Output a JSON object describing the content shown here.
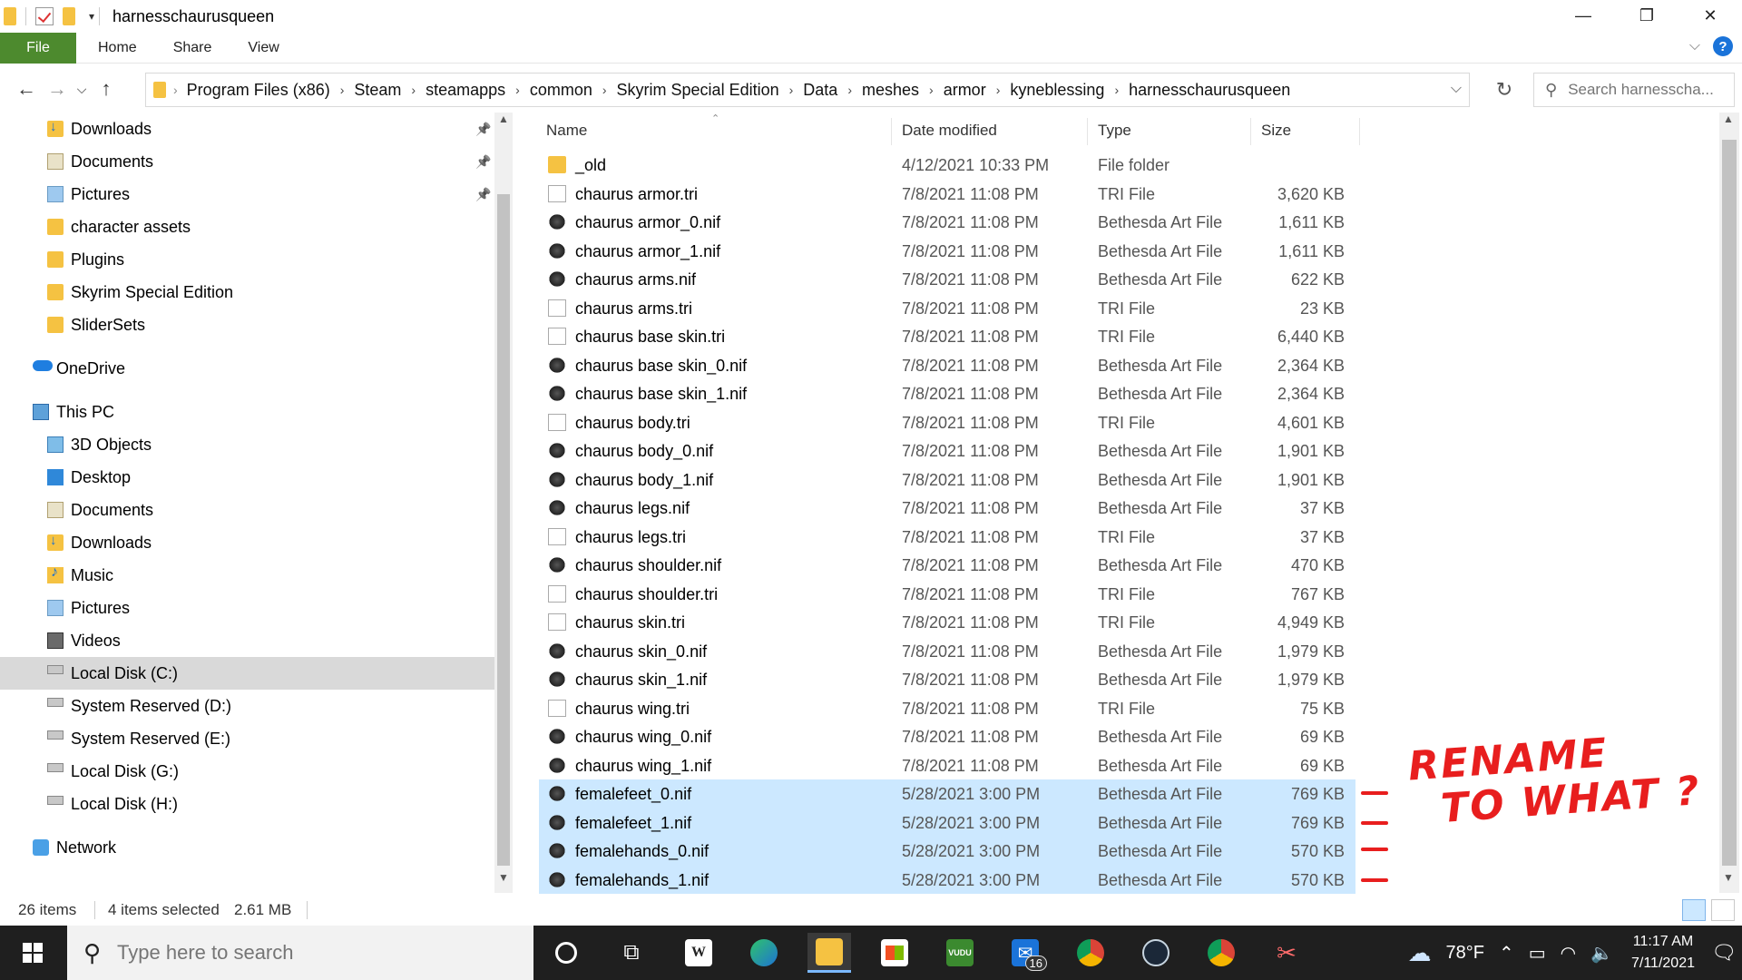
{
  "window": {
    "title": "harnesschaurusqueen",
    "controls": {
      "minimize": "—",
      "restore": "❐",
      "close": "✕"
    }
  },
  "ribbon": {
    "tabs": [
      "File",
      "Home",
      "Share",
      "View"
    ],
    "help": "?"
  },
  "address": {
    "crumbs": [
      "Program Files (x86)",
      "Steam",
      "steamapps",
      "common",
      "Skyrim Special Edition",
      "Data",
      "meshes",
      "armor",
      "kyneblessing",
      "harnesschaurusqueen"
    ],
    "search_placeholder": "Search harnesscha..."
  },
  "nav_pane": [
    {
      "label": "Downloads",
      "icon": "downloads-folder-icon",
      "pinned": true
    },
    {
      "label": "Documents",
      "icon": "documents-folder-icon",
      "pinned": true
    },
    {
      "label": "Pictures",
      "icon": "pictures-folder-icon",
      "pinned": true
    },
    {
      "label": "character assets",
      "icon": "folder-icon"
    },
    {
      "label": "Plugins",
      "icon": "folder-icon"
    },
    {
      "label": "Skyrim Special Edition",
      "icon": "folder-icon"
    },
    {
      "label": "SliderSets",
      "icon": "folder-icon"
    },
    {
      "label": "OneDrive",
      "icon": "onedrive-cloud-icon"
    },
    {
      "label": "This PC",
      "icon": "this-pc-icon"
    },
    {
      "label": "3D Objects",
      "icon": "3d-objects-icon"
    },
    {
      "label": "Desktop",
      "icon": "desktop-icon"
    },
    {
      "label": "Documents",
      "icon": "documents-folder-icon"
    },
    {
      "label": "Downloads",
      "icon": "downloads-folder-icon"
    },
    {
      "label": "Music",
      "icon": "music-folder-icon"
    },
    {
      "label": "Pictures",
      "icon": "pictures-folder-icon"
    },
    {
      "label": "Videos",
      "icon": "videos-folder-icon"
    },
    {
      "label": "Local Disk (C:)",
      "icon": "drive-icon",
      "selected": true
    },
    {
      "label": "System Reserved (D:)",
      "icon": "drive-icon"
    },
    {
      "label": "System Reserved (E:)",
      "icon": "drive-icon"
    },
    {
      "label": "Local Disk (G:)",
      "icon": "drive-icon"
    },
    {
      "label": "Local Disk (H:)",
      "icon": "drive-icon"
    },
    {
      "label": "Network",
      "icon": "network-icon"
    }
  ],
  "columns": {
    "name": "Name",
    "date": "Date modified",
    "type": "Type",
    "size": "Size"
  },
  "files": [
    {
      "name": "_old",
      "date": "4/12/2021 10:33 PM",
      "type": "File folder",
      "size": "",
      "kind": "folder"
    },
    {
      "name": "chaurus armor.tri",
      "date": "7/8/2021 11:08 PM",
      "type": "TRI File",
      "size": "3,620 KB",
      "kind": "tri"
    },
    {
      "name": "chaurus armor_0.nif",
      "date": "7/8/2021 11:08 PM",
      "type": "Bethesda Art File",
      "size": "1,611 KB",
      "kind": "nif"
    },
    {
      "name": "chaurus armor_1.nif",
      "date": "7/8/2021 11:08 PM",
      "type": "Bethesda Art File",
      "size": "1,611 KB",
      "kind": "nif"
    },
    {
      "name": "chaurus arms.nif",
      "date": "7/8/2021 11:08 PM",
      "type": "Bethesda Art File",
      "size": "622 KB",
      "kind": "nif"
    },
    {
      "name": "chaurus arms.tri",
      "date": "7/8/2021 11:08 PM",
      "type": "TRI File",
      "size": "23 KB",
      "kind": "tri"
    },
    {
      "name": "chaurus base skin.tri",
      "date": "7/8/2021 11:08 PM",
      "type": "TRI File",
      "size": "6,440 KB",
      "kind": "tri"
    },
    {
      "name": "chaurus base skin_0.nif",
      "date": "7/8/2021 11:08 PM",
      "type": "Bethesda Art File",
      "size": "2,364 KB",
      "kind": "nif"
    },
    {
      "name": "chaurus base skin_1.nif",
      "date": "7/8/2021 11:08 PM",
      "type": "Bethesda Art File",
      "size": "2,364 KB",
      "kind": "nif"
    },
    {
      "name": "chaurus body.tri",
      "date": "7/8/2021 11:08 PM",
      "type": "TRI File",
      "size": "4,601 KB",
      "kind": "tri"
    },
    {
      "name": "chaurus body_0.nif",
      "date": "7/8/2021 11:08 PM",
      "type": "Bethesda Art File",
      "size": "1,901 KB",
      "kind": "nif"
    },
    {
      "name": "chaurus body_1.nif",
      "date": "7/8/2021 11:08 PM",
      "type": "Bethesda Art File",
      "size": "1,901 KB",
      "kind": "nif"
    },
    {
      "name": "chaurus legs.nif",
      "date": "7/8/2021 11:08 PM",
      "type": "Bethesda Art File",
      "size": "37 KB",
      "kind": "nif"
    },
    {
      "name": "chaurus legs.tri",
      "date": "7/8/2021 11:08 PM",
      "type": "TRI File",
      "size": "37 KB",
      "kind": "tri"
    },
    {
      "name": "chaurus shoulder.nif",
      "date": "7/8/2021 11:08 PM",
      "type": "Bethesda Art File",
      "size": "470 KB",
      "kind": "nif"
    },
    {
      "name": "chaurus shoulder.tri",
      "date": "7/8/2021 11:08 PM",
      "type": "TRI File",
      "size": "767 KB",
      "kind": "tri"
    },
    {
      "name": "chaurus skin.tri",
      "date": "7/8/2021 11:08 PM",
      "type": "TRI File",
      "size": "4,949 KB",
      "kind": "tri"
    },
    {
      "name": "chaurus skin_0.nif",
      "date": "7/8/2021 11:08 PM",
      "type": "Bethesda Art File",
      "size": "1,979 KB",
      "kind": "nif"
    },
    {
      "name": "chaurus skin_1.nif",
      "date": "7/8/2021 11:08 PM",
      "type": "Bethesda Art File",
      "size": "1,979 KB",
      "kind": "nif"
    },
    {
      "name": "chaurus wing.tri",
      "date": "7/8/2021 11:08 PM",
      "type": "TRI File",
      "size": "75 KB",
      "kind": "tri"
    },
    {
      "name": "chaurus wing_0.nif",
      "date": "7/8/2021 11:08 PM",
      "type": "Bethesda Art File",
      "size": "69 KB",
      "kind": "nif"
    },
    {
      "name": "chaurus wing_1.nif",
      "date": "7/8/2021 11:08 PM",
      "type": "Bethesda Art File",
      "size": "69 KB",
      "kind": "nif"
    },
    {
      "name": "femalefeet_0.nif",
      "date": "5/28/2021 3:00 PM",
      "type": "Bethesda Art File",
      "size": "769 KB",
      "kind": "nif",
      "selected": true
    },
    {
      "name": "femalefeet_1.nif",
      "date": "5/28/2021 3:00 PM",
      "type": "Bethesda Art File",
      "size": "769 KB",
      "kind": "nif",
      "selected": true
    },
    {
      "name": "femalehands_0.nif",
      "date": "5/28/2021 3:00 PM",
      "type": "Bethesda Art File",
      "size": "570 KB",
      "kind": "nif",
      "selected": true
    },
    {
      "name": "femalehands_1.nif",
      "date": "5/28/2021 3:00 PM",
      "type": "Bethesda Art File",
      "size": "570 KB",
      "kind": "nif",
      "selected": true
    }
  ],
  "status": {
    "count": "26 items",
    "selected": "4 items selected",
    "selected_size": "2.61 MB"
  },
  "annotation": {
    "line1": "RENAME",
    "line2": "TO WHAT ?",
    "color": "#e81e1e"
  },
  "taskbar": {
    "search_placeholder": "Type here to search",
    "mail_badge": "16",
    "weather": "78°F",
    "time": "11:17 AM",
    "date": "7/11/2021",
    "word_letter": "W",
    "vudu_label": "VUDU"
  },
  "colors": {
    "file_tab": "#4d8a2e",
    "selection": "#cce8ff",
    "folder": "#f5c242",
    "taskbar": "#1f1f1f"
  }
}
